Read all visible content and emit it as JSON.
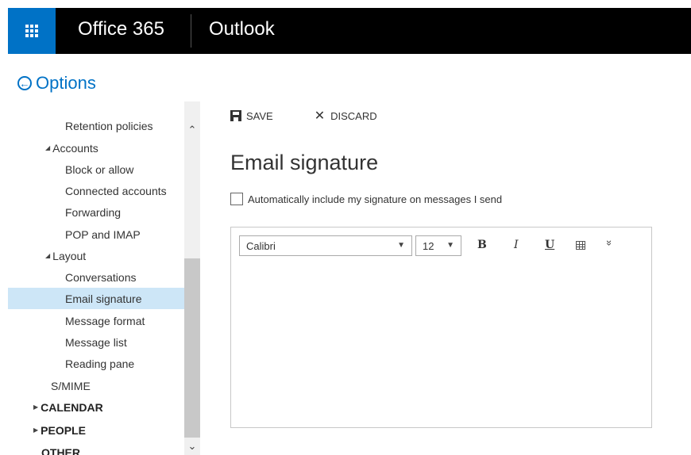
{
  "header": {
    "brand": "Office 365",
    "app": "Outlook",
    "accent": "#0072c6"
  },
  "options": {
    "title": "Options",
    "icon": "back-arrow-circle-icon"
  },
  "sidebar": {
    "items": [
      {
        "label": "Retention policies",
        "level": 2
      },
      {
        "label": "Accounts",
        "level": 1,
        "expanded": true
      },
      {
        "label": "Block or allow",
        "level": 2
      },
      {
        "label": "Connected accounts",
        "level": 2
      },
      {
        "label": "Forwarding",
        "level": 2
      },
      {
        "label": "POP and IMAP",
        "level": 2
      },
      {
        "label": "Layout",
        "level": 1,
        "expanded": true
      },
      {
        "label": "Conversations",
        "level": 2
      },
      {
        "label": "Email signature",
        "level": 2,
        "selected": true
      },
      {
        "label": "Message format",
        "level": 2
      },
      {
        "label": "Message list",
        "level": 2
      },
      {
        "label": "Reading pane",
        "level": 2
      },
      {
        "label": "S/MIME",
        "level": 1
      },
      {
        "label": "CALENDAR",
        "level": 0,
        "collapsed": true
      },
      {
        "label": "PEOPLE",
        "level": 0,
        "collapsed": true
      },
      {
        "label": "OTHER",
        "level": 0
      }
    ]
  },
  "toolbar": {
    "save_label": "SAVE",
    "discard_label": "DISCARD"
  },
  "page": {
    "title": "Email signature",
    "checkbox_label": "Automatically include my signature on messages I send",
    "checkbox_checked": false
  },
  "editor": {
    "font": "Calibri",
    "size": "12",
    "bold": "B",
    "italic": "I",
    "underline": "U",
    "content": ""
  }
}
